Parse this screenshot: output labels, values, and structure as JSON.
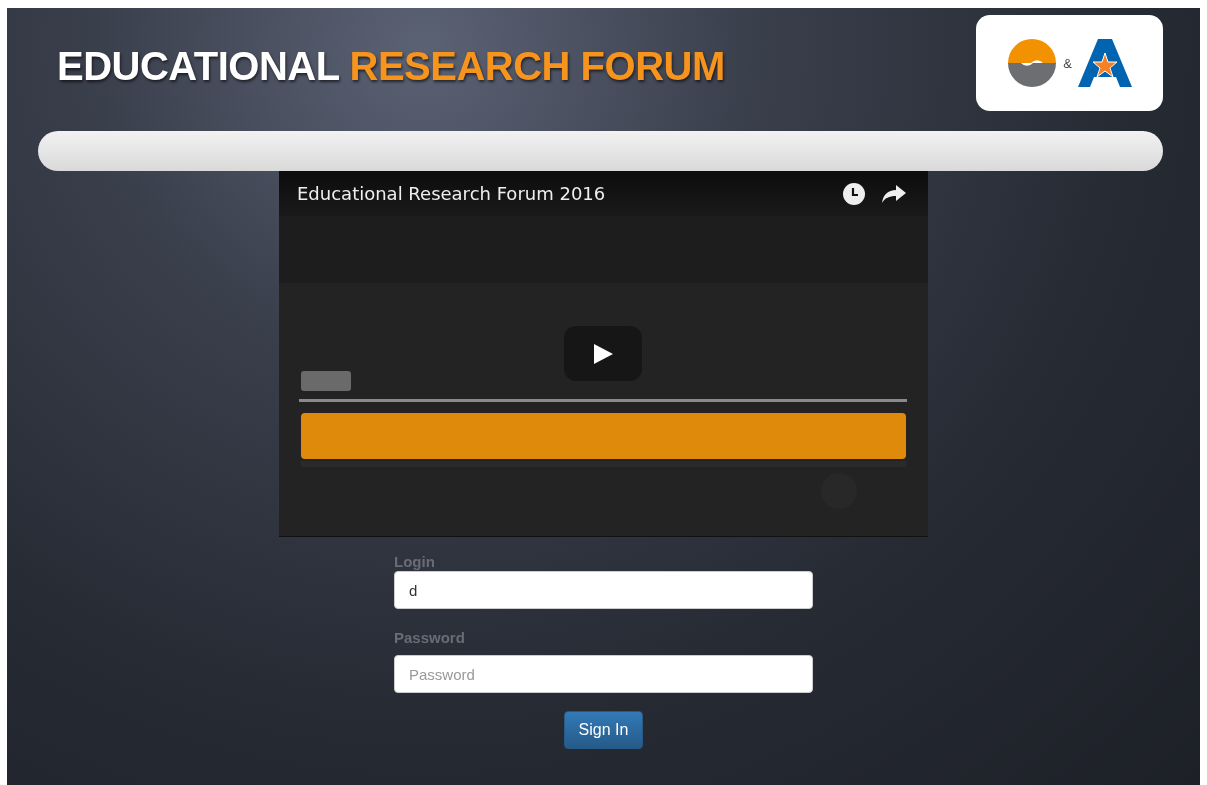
{
  "header": {
    "title_plain": "EDUCATIONAL",
    "title_accent": "RESEARCH FORUM",
    "logo_separator": "&"
  },
  "video": {
    "title": "Educational Research Forum 2016",
    "kind": "picture"
  },
  "form": {
    "login_label": "Login",
    "login_value": "d",
    "password_label": "Password",
    "password_placeholder": "Password",
    "submit": "Sign In"
  }
}
